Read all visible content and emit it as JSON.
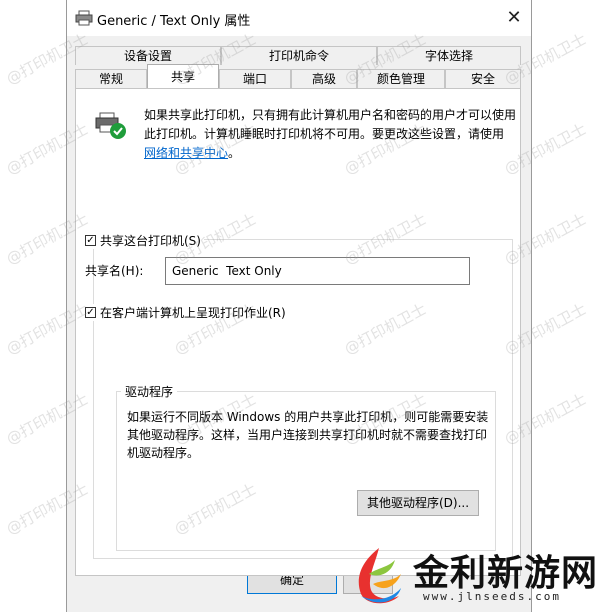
{
  "window": {
    "title": "Generic / Text Only 属性",
    "close_symbol": "✕"
  },
  "tabs_row1": [
    "设备设置",
    "打印机命令",
    "字体选择"
  ],
  "tabs_row2": [
    "常规",
    "共享",
    "端口",
    "高级",
    "颜色管理",
    "安全"
  ],
  "active_tab": "共享",
  "sharing": {
    "description": "如果共享此打印机，只有拥有此计算机用户名和密码的用户才可以使用此打印机。计算机睡眠时打印机将不可用。要更改这些设置，请使用",
    "link_text": "网络和共享中心",
    "link_suffix": "。",
    "share_checkbox_label": "共享这台打印机(S)",
    "share_checked": true,
    "share_name_label": "共享名(H):",
    "share_name_value": "Generic  Text Only",
    "render_checkbox_label": "在客户端计算机上呈现打印作业(R)",
    "render_checked": true
  },
  "drivers": {
    "title": "驱动程序",
    "text": "如果运行不同版本 Windows 的用户共享此打印机，则可能需要安装其他驱动程序。这样，当用户连接到共享打印机时就不需要查找打印机驱动程序。",
    "button_label": "其他驱动程序(D)..."
  },
  "buttons": {
    "ok": "确定"
  },
  "watermark": {
    "text": "@打印机卫士"
  },
  "logo": {
    "text": "金利新游网",
    "url": "www.jlnseeds.com"
  }
}
